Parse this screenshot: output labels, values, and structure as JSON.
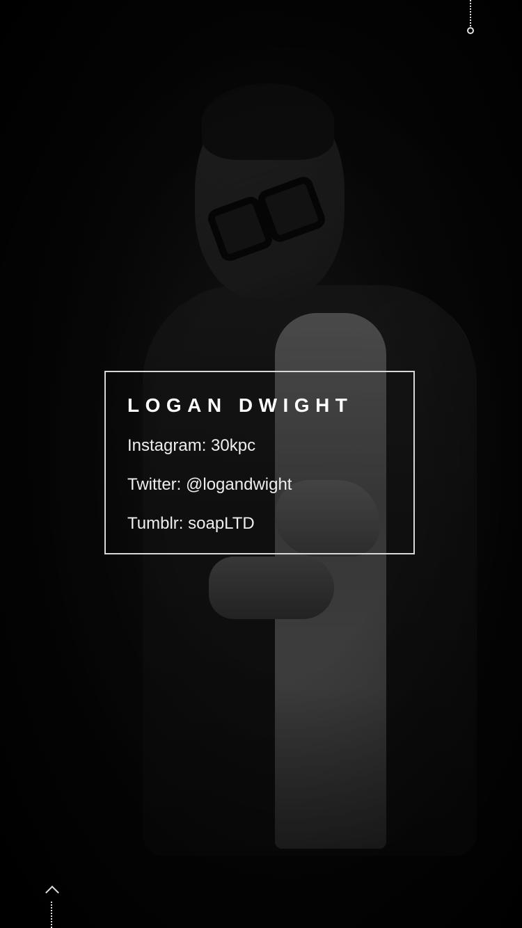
{
  "profile": {
    "name": "LOGAN DWIGHT",
    "instagram": "Instagram: 30kpc",
    "twitter": "Twitter: @logandwight",
    "tumblr": "Tumblr: soapLTD"
  },
  "icons": {
    "top_indicator": "dotted-line-circle-icon",
    "scroll_up": "chevron-up-icon"
  },
  "colors": {
    "background": "#050505",
    "text": "#ffffff",
    "card_border": "#d8d8d8"
  }
}
